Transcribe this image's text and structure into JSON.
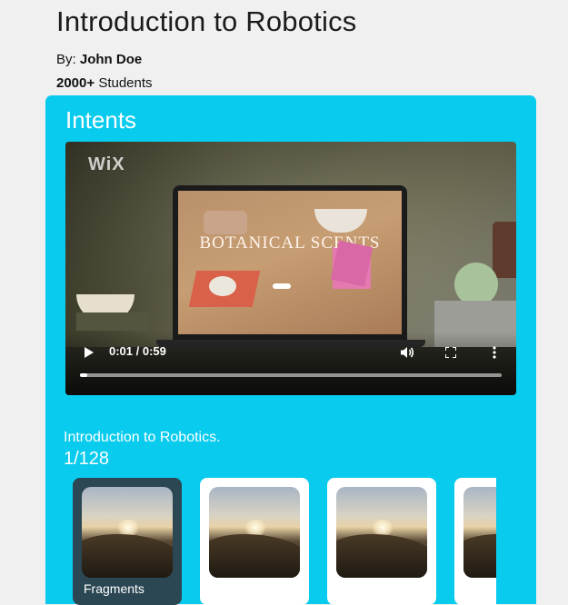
{
  "course": {
    "title": "Introduction to Robotics",
    "by_label": "By:",
    "author": "John Doe",
    "students_count": "2000+",
    "students_label": "Students"
  },
  "panel": {
    "title": "Intents"
  },
  "video": {
    "logo_text": "WiX",
    "screen_text": "BOTANICAL SCENTS",
    "current_time": "0:01",
    "duration": "0:59",
    "time_display": "0:01 / 0:59",
    "progress_fraction": 0.017
  },
  "lesson": {
    "title": "Introduction to Robotics.",
    "counter": "1/128"
  },
  "cards": [
    {
      "label": "Fragments",
      "active": true
    },
    {
      "label": "",
      "active": false
    },
    {
      "label": "",
      "active": false
    },
    {
      "label": "",
      "active": false
    }
  ],
  "colors": {
    "panel_bg": "#08cbee",
    "active_card_bg": "#2b4753",
    "card_bg": "#ffffff"
  }
}
